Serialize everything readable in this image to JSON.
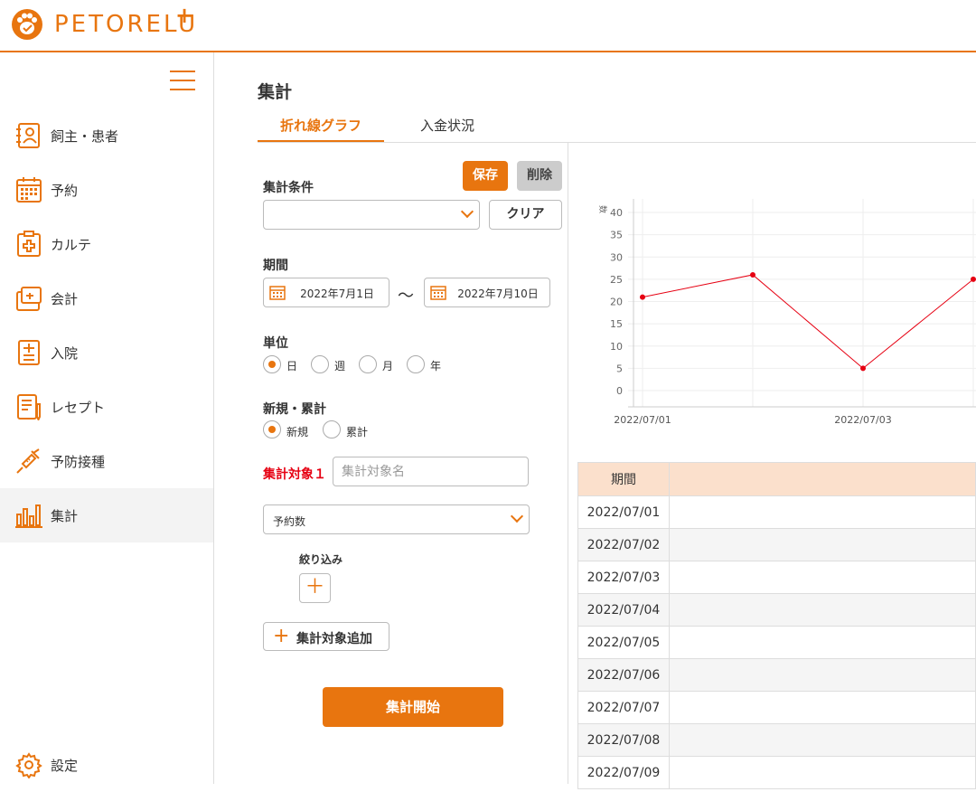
{
  "app": {
    "logo_text": "PETORELU",
    "logo_plus": "+"
  },
  "sidebar": {
    "items": [
      {
        "label": "飼主・患者",
        "icon": "patient-card-icon"
      },
      {
        "label": "予約",
        "icon": "calendar-icon"
      },
      {
        "label": "カルテ",
        "icon": "medical-chart-icon"
      },
      {
        "label": "会計",
        "icon": "register-icon"
      },
      {
        "label": "入院",
        "icon": "hospital-admission-icon"
      },
      {
        "label": "レセプト",
        "icon": "receipt-icon"
      },
      {
        "label": "予防接種",
        "icon": "syringe-icon"
      },
      {
        "label": "集計",
        "icon": "bar-chart-icon"
      }
    ],
    "settings_label": "設定",
    "active": "集計"
  },
  "page": {
    "title": "集計",
    "tabs": [
      "折れ線グラフ",
      "入金状況"
    ],
    "active_tab": "折れ線グラフ"
  },
  "form": {
    "condition_label": "集計条件",
    "save_label": "保存",
    "delete_label": "削除",
    "condition_value": "",
    "clear_label": "クリア",
    "period_label": "期間",
    "date_from": "2022年7月1日",
    "tilde": "〜",
    "date_to": "2022年7月10日",
    "unit_label": "単位",
    "unit_options": [
      "日",
      "週",
      "月",
      "年"
    ],
    "unit_selected": "日",
    "mode_label": "新規・累計",
    "mode_options": [
      "新規",
      "累計"
    ],
    "mode_selected": "新規",
    "target1_label": "集計対象１",
    "target_name_placeholder": "集計対象名",
    "target_metric": "予約数",
    "filter_label": "絞り込み",
    "filter_add": "＋",
    "add_target_label": "集計対象追加",
    "start_label": "集計開始"
  },
  "chart_data": {
    "type": "line",
    "ylabel": "数",
    "ylim": [
      0,
      40
    ],
    "yticks": [
      0,
      5,
      10,
      15,
      20,
      25,
      30,
      35,
      40
    ],
    "x": [
      "2022/07/01",
      "2022/07/02",
      "2022/07/03",
      "2022/07/04"
    ],
    "xtick_labels": [
      "2022/07/01",
      "",
      "2022/07/03",
      ""
    ],
    "series": [
      {
        "values": [
          21,
          26,
          5,
          25
        ],
        "color": "#e60012"
      }
    ],
    "grid": true
  },
  "table": {
    "header": [
      "期間",
      ""
    ],
    "rows": [
      "2022/07/01",
      "2022/07/02",
      "2022/07/03",
      "2022/07/04",
      "2022/07/05",
      "2022/07/06",
      "2022/07/07",
      "2022/07/08",
      "2022/07/09"
    ]
  },
  "colors": {
    "accent": "#e8750f",
    "danger": "#e60012",
    "table_header": "#fbe0cc"
  }
}
